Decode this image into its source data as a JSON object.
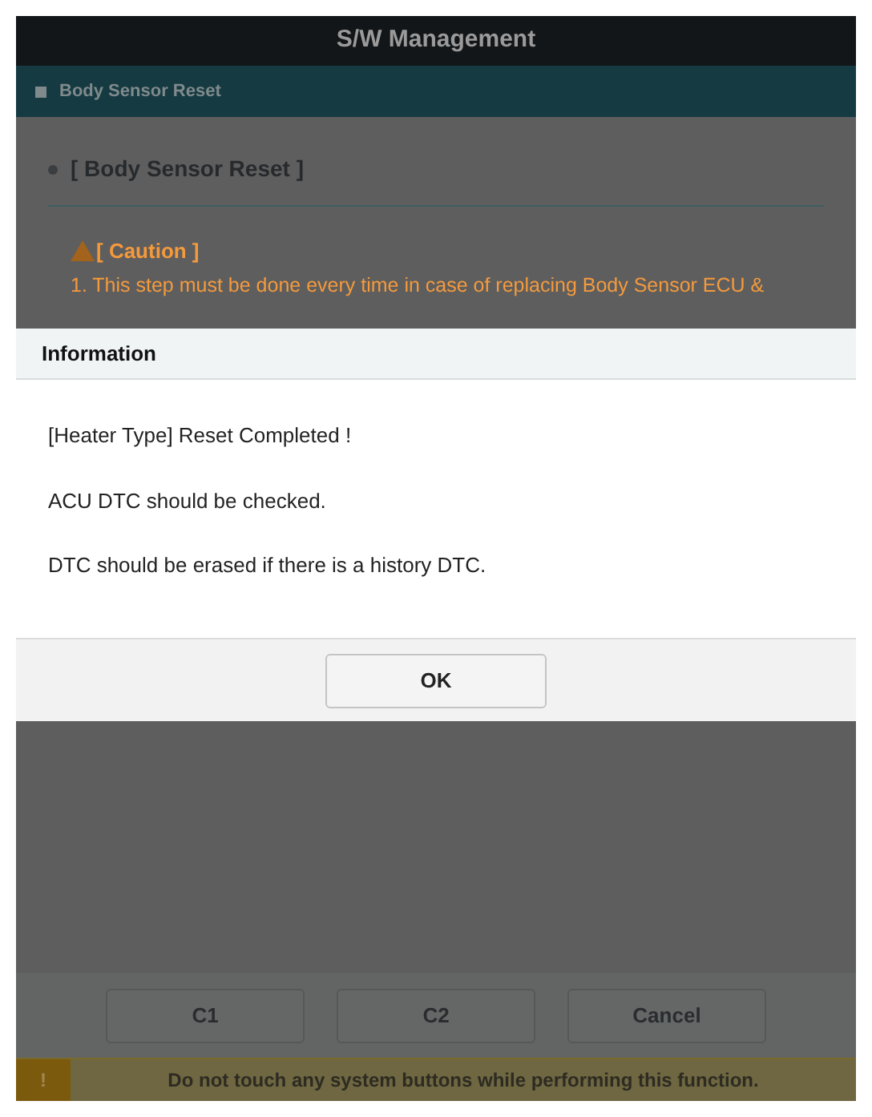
{
  "window": {
    "title": "S/W Management"
  },
  "section_bar": {
    "label": "Body Sensor Reset"
  },
  "content": {
    "heading": "[ Body Sensor Reset ]",
    "caution": {
      "title": "[ Caution ]",
      "lines": [
        "1. This step must be done every time in case of replacing Body Sensor ECU &"
      ]
    }
  },
  "dialog": {
    "title": "Information",
    "messages": [
      "[Heater Type] Reset Completed !",
      "ACU DTC should be checked.",
      "DTC should be erased if there is a history DTC."
    ],
    "button": "OK"
  },
  "buttons": [
    "C1",
    "C2",
    "Cancel"
  ],
  "footer": {
    "icon": "!",
    "message": "Do not touch any system buttons while performing this function."
  }
}
